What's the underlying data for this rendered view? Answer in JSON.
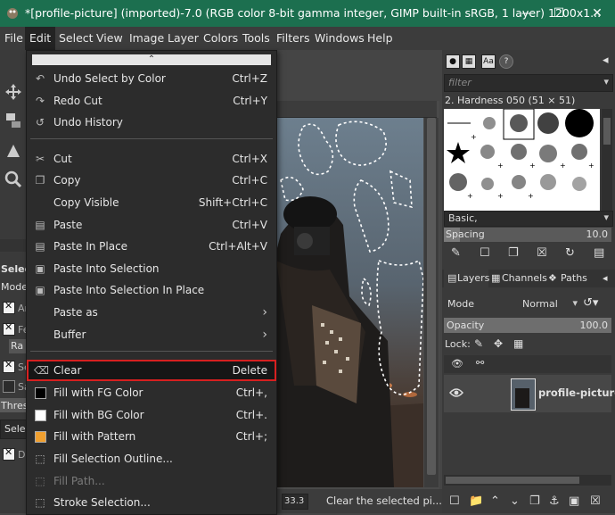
{
  "window": {
    "title": "*[profile-picture] (imported)-7.0 (RGB color 8-bit gamma integer, GIMP built-in sRGB, 1 layer) 1200x1...",
    "minimize": "—",
    "maximize": "☐",
    "close": "✕"
  },
  "menubar": [
    "File",
    "Edit",
    "Select",
    "View",
    "Image",
    "Layer",
    "Colors",
    "Tools",
    "Filters",
    "Windows",
    "Help"
  ],
  "edit_menu": {
    "tearoff": "⌃",
    "items": [
      {
        "label": "Undo Select by Color",
        "shortcut": "Ctrl+Z",
        "icon": "↶"
      },
      {
        "label": "Redo Cut",
        "shortcut": "Ctrl+Y",
        "icon": "↷"
      },
      {
        "label": "Undo History",
        "shortcut": "",
        "icon": "↺"
      },
      {
        "label": "Cut",
        "shortcut": "Ctrl+X",
        "icon": "✂"
      },
      {
        "label": "Copy",
        "shortcut": "Ctrl+C",
        "icon": "❐"
      },
      {
        "label": "Copy Visible",
        "shortcut": "Shift+Ctrl+C",
        "icon": ""
      },
      {
        "label": "Paste",
        "shortcut": "Ctrl+V",
        "icon": "▤"
      },
      {
        "label": "Paste In Place",
        "shortcut": "Ctrl+Alt+V",
        "icon": "▤"
      },
      {
        "label": "Paste Into Selection",
        "shortcut": "",
        "icon": "▣"
      },
      {
        "label": "Paste Into Selection In Place",
        "shortcut": "",
        "icon": "▣"
      },
      {
        "label": "Paste as",
        "shortcut": "",
        "icon": ""
      },
      {
        "label": "Buffer",
        "shortcut": "",
        "icon": ""
      },
      {
        "label": "Clear",
        "shortcut": "Delete",
        "icon": "⌫"
      },
      {
        "label": "Fill with FG Color",
        "shortcut": "Ctrl+,",
        "icon": ""
      },
      {
        "label": "Fill with BG Color",
        "shortcut": "Ctrl+.",
        "icon": ""
      },
      {
        "label": "Fill with Pattern",
        "shortcut": "Ctrl+;",
        "icon": ""
      },
      {
        "label": "Fill Selection Outline...",
        "shortcut": "",
        "icon": "⬚"
      },
      {
        "label": "Fill Path...",
        "shortcut": "",
        "icon": "⬚"
      },
      {
        "label": "Stroke Selection...",
        "shortcut": "",
        "icon": "⬚"
      }
    ]
  },
  "tool_options": {
    "title": "Selec",
    "mode": "Mode",
    "antialias": "An",
    "feather": "Fe",
    "radius": "Ra",
    "select_transparent": "Se",
    "sample_merged": "Sa",
    "threshold": "Thres",
    "select_by": "Selec",
    "draw_mask": "Dr"
  },
  "canvas": {
    "status_zoom": "33.3",
    "status_msg": "Clear the selected pi..."
  },
  "brushes": {
    "filter_placeholder": "filter",
    "current": "2. Hardness 050 (51 × 51)",
    "preset": "Basic,",
    "spacing_label": "Spacing",
    "spacing_value": "10.0"
  },
  "layers": {
    "tab_layers": "Layers",
    "tab_channels": "Channels",
    "tab_paths": "Paths",
    "mode_label": "Mode",
    "mode_value": "Normal",
    "opacity_label": "Opacity",
    "opacity_value": "100.0",
    "lock_label": "Lock:",
    "layer_name": "profile-picture.j"
  },
  "colors": {
    "titlebar": "#1c6f4f",
    "highlight_border": "#d62020",
    "fg_color": "#000000",
    "bg_color": "#ffffff",
    "pattern": "#f0a030"
  }
}
